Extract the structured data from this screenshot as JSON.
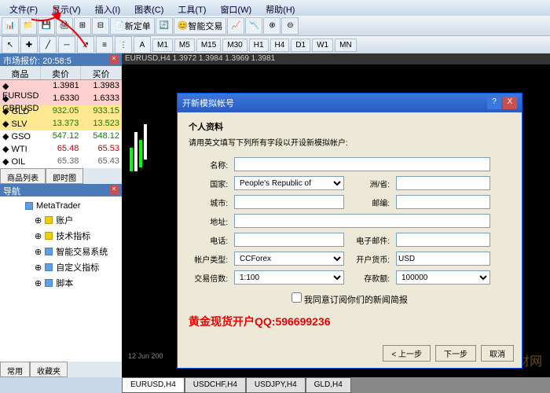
{
  "menu": {
    "file": "文件(F)",
    "view": "显示(V)",
    "insert": "插入(I)",
    "charts": "图表(C)",
    "tools": "工具(T)",
    "window": "窗口(W)",
    "help": "帮助(H)"
  },
  "toolbar": {
    "new_order": "新定单",
    "auto_trade": "智能交易"
  },
  "timeframes": [
    "M1",
    "M5",
    "M15",
    "M30",
    "H1",
    "H4",
    "D1",
    "W1",
    "MN"
  ],
  "market": {
    "title": "市场报价: 20:58:5",
    "cols": {
      "symbol": "商品",
      "bid": "卖价",
      "ask": "买价"
    },
    "rows": [
      {
        "sym": "EURUSD",
        "bid": "1.3981",
        "ask": "1.3983",
        "cls": "pink"
      },
      {
        "sym": "GBPUSD",
        "bid": "1.6330",
        "ask": "1.6333",
        "cls": "pink"
      },
      {
        "sym": "GLD",
        "bid": "932.05",
        "ask": "933.15",
        "cls": "yel",
        "tc": "green"
      },
      {
        "sym": "SLV",
        "bid": "13.373",
        "ask": "13.523",
        "cls": "yel",
        "tc": "green"
      },
      {
        "sym": "GSO",
        "bid": "547.12",
        "ask": "548.12",
        "cls": "",
        "tc": "green"
      },
      {
        "sym": "WTI",
        "bid": "65.48",
        "ask": "65.53",
        "cls": "",
        "tc": "red"
      },
      {
        "sym": "OIL",
        "bid": "65.38",
        "ask": "65.43",
        "cls": "",
        "tc": "gray"
      }
    ],
    "tab1": "商品列表",
    "tab2": "即时图"
  },
  "nav": {
    "title": "导航",
    "root": "MetaTrader",
    "items": [
      "账户",
      "技术指标",
      "智能交易系统",
      "自定义指标",
      "脚本"
    ]
  },
  "chart": {
    "header": "EURUSD,H4  1.3972  1.3984  1.3969  1.3981",
    "date": "12 Jun 200"
  },
  "dialog": {
    "title": "开新模拟帐号",
    "section": "个人资料",
    "note": "请用英文填写下列所有字段以开设新模拟帐户:",
    "labels": {
      "name": "名称:",
      "country": "国家:",
      "state": "洲/省:",
      "city": "城市:",
      "zip": "邮编:",
      "address": "地址:",
      "phone": "电话:",
      "email": "电子邮件:",
      "acc_type": "帐户类型:",
      "currency": "开户货币:",
      "leverage": "交易倍数:",
      "deposit": "存款额:"
    },
    "values": {
      "country": "People's Republic of",
      "acc_type": "CCForex",
      "currency": "USD",
      "leverage": "1:100",
      "deposit": "100000"
    },
    "checkbox": "我同意订阅你们的新闻简报",
    "promo": "黄金现货开户QQ:596699236",
    "btn_prev": "< 上一步",
    "btn_next": "下一步",
    "btn_cancel": "取消"
  },
  "bottom_tabs": {
    "common": "常用",
    "fav": "收藏夹"
  },
  "chart_tabs": [
    "EURUSD,H4",
    "USDCHF,H4",
    "USDJPY,H4",
    "GLD,H4"
  ],
  "watermark": "理财网"
}
